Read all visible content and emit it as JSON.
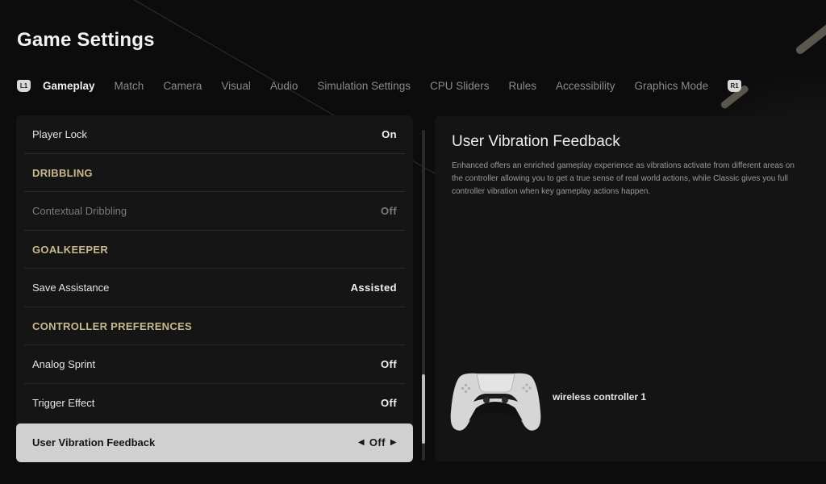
{
  "header": {
    "title": "Game Settings"
  },
  "tabs": {
    "left_bumper": "L1",
    "right_bumper": "R1",
    "items": [
      {
        "label": "Gameplay",
        "active": true
      },
      {
        "label": "Match",
        "active": false
      },
      {
        "label": "Camera",
        "active": false
      },
      {
        "label": "Visual",
        "active": false
      },
      {
        "label": "Audio",
        "active": false
      },
      {
        "label": "Simulation Settings",
        "active": false
      },
      {
        "label": "CPU Sliders",
        "active": false
      },
      {
        "label": "Rules",
        "active": false
      },
      {
        "label": "Accessibility",
        "active": false
      },
      {
        "label": "Graphics Mode",
        "active": false
      }
    ]
  },
  "settings": {
    "rows": [
      {
        "type": "setting",
        "label": "Player Lock",
        "value": "On",
        "disabled": false
      },
      {
        "type": "section",
        "label": "DRIBBLING"
      },
      {
        "type": "setting",
        "label": "Contextual Dribbling",
        "value": "Off",
        "disabled": true
      },
      {
        "type": "section",
        "label": "GOALKEEPER"
      },
      {
        "type": "setting",
        "label": "Save Assistance",
        "value": "Assisted",
        "disabled": false
      },
      {
        "type": "section",
        "label": "CONTROLLER PREFERENCES"
      },
      {
        "type": "setting",
        "label": "Analog Sprint",
        "value": "Off",
        "disabled": false
      },
      {
        "type": "setting",
        "label": "Trigger Effect",
        "value": "Off",
        "disabled": false
      },
      {
        "type": "setting",
        "label": "User Vibration Feedback",
        "value": "Off",
        "disabled": false,
        "selected": true
      }
    ],
    "arrow_left": "◀",
    "arrow_right": "▶",
    "scroll": {
      "thumb_start_fraction": 0.74,
      "thumb_size_fraction": 0.21
    }
  },
  "detail": {
    "title": "User Vibration Feedback",
    "description": "Enhanced offers an enriched gameplay experience as vibrations activate from different areas on the controller allowing you to get a true sense of real world actions, while Classic gives you full controller vibration when key gameplay actions happen.",
    "controller_name": "wireless controller 1"
  },
  "colors": {
    "section_header": "#c8b98f",
    "selected_row_bg": "#d0d0d0",
    "panel_bg": "#151515",
    "page_bg": "#0c0c0c"
  }
}
